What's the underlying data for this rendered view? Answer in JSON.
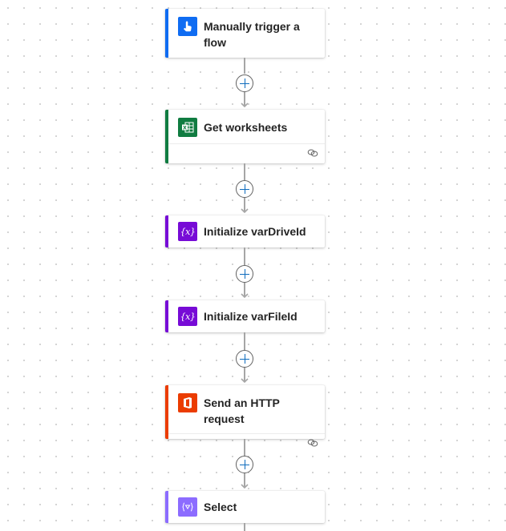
{
  "flow": {
    "steps": [
      {
        "title": "Manually trigger a flow",
        "icon": "touch-hand-icon",
        "accent": "#0f6cf2",
        "has_connection": false
      },
      {
        "title": "Get worksheets",
        "icon": "excel-icon",
        "accent": "#107c41",
        "has_connection": true
      },
      {
        "title": "Initialize varDriveId",
        "icon": "variable-icon",
        "accent": "#770bd6",
        "has_connection": false
      },
      {
        "title": "Initialize varFileId",
        "icon": "variable-icon",
        "accent": "#770bd6",
        "has_connection": false
      },
      {
        "title": "Send an HTTP request",
        "icon": "office-icon",
        "accent": "#eb3c00",
        "has_connection": true
      },
      {
        "title": "Select",
        "icon": "data-operation-icon",
        "accent": "#8c6cff",
        "has_connection": false
      }
    ],
    "add_step_label": "Insert a new step",
    "connection_icon": "link-icon"
  }
}
